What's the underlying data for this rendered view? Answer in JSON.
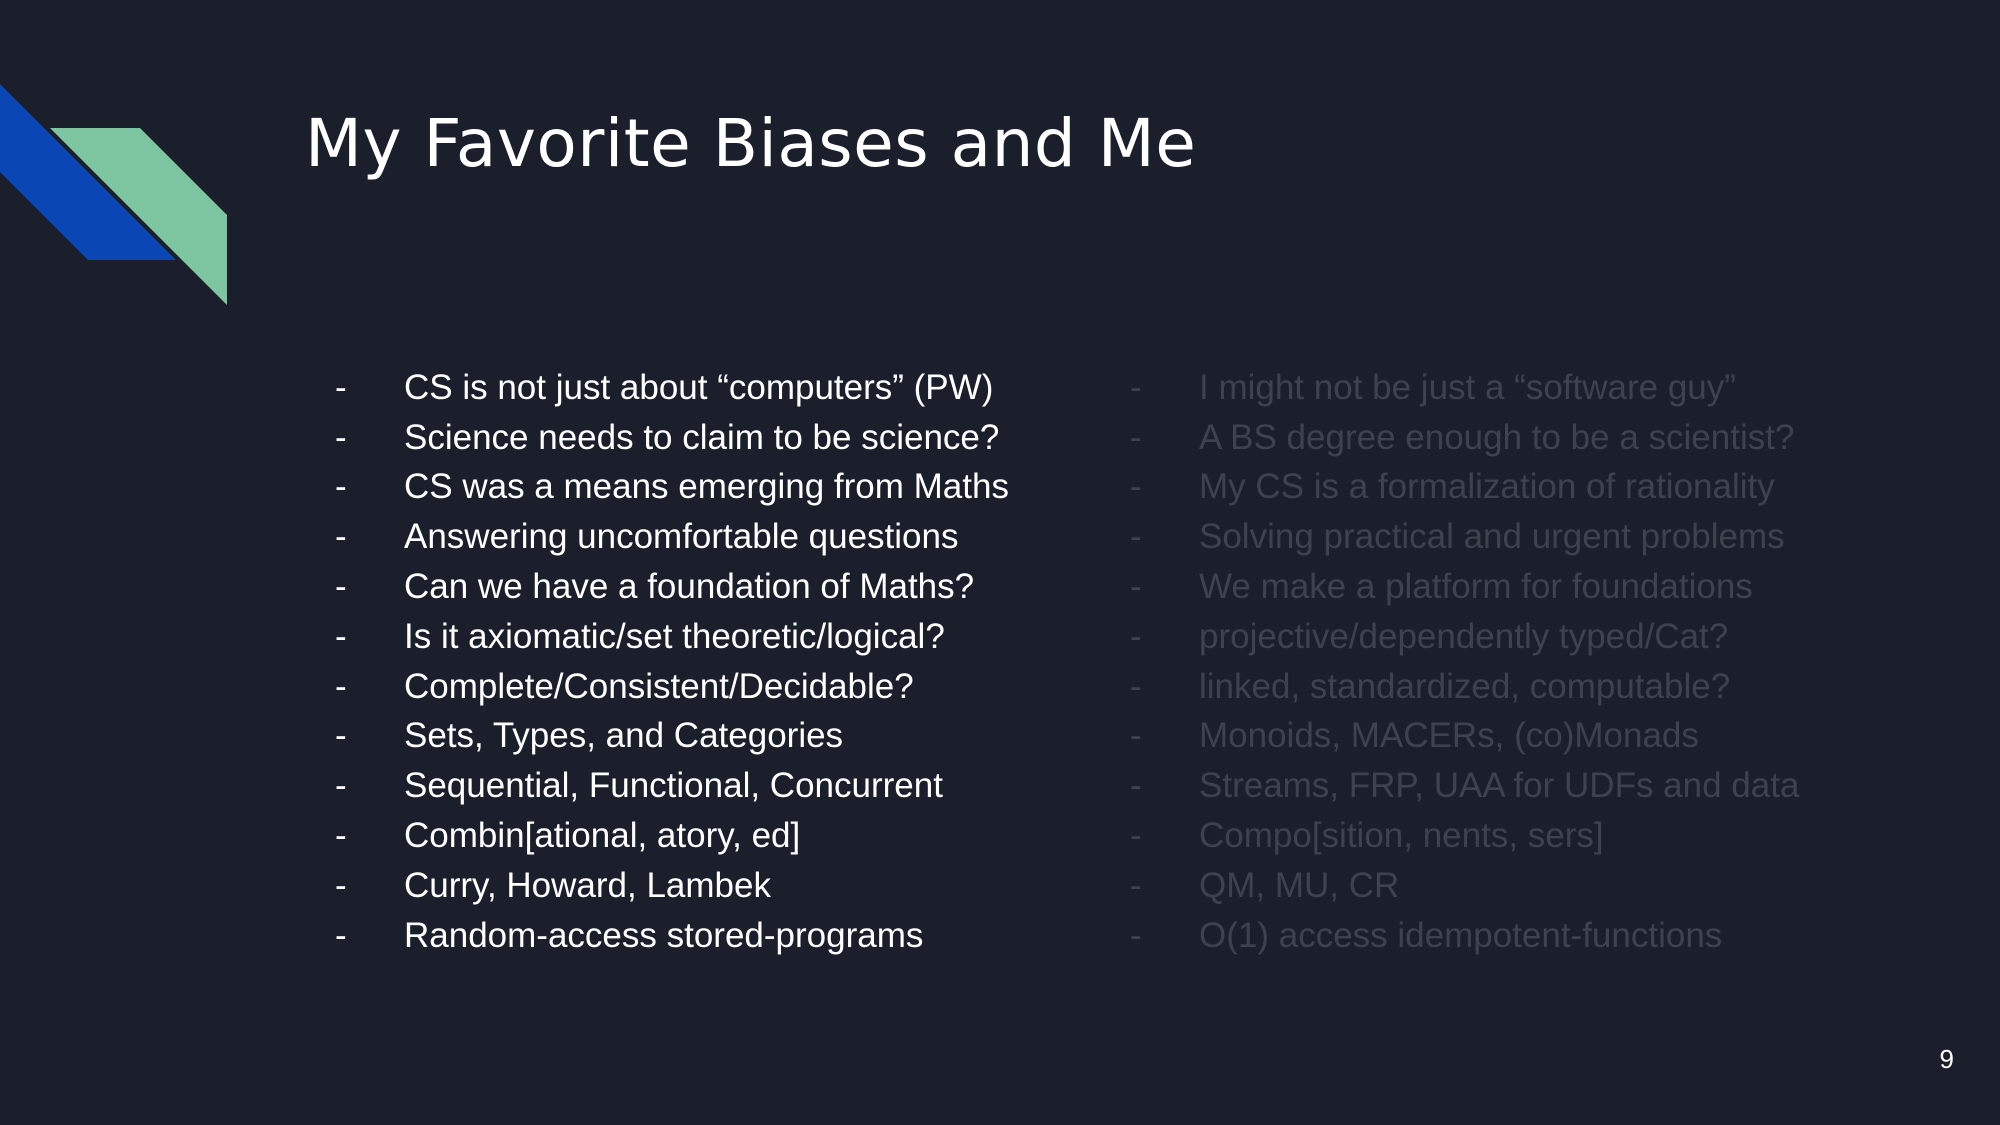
{
  "slide": {
    "title": "My Favorite Biases and Me",
    "page_number": "9",
    "bullet": "-",
    "colors": {
      "background": "#1b1f2b",
      "accent_blue": "#0a47b5",
      "accent_green": "#7ec6a2",
      "text_primary": "#ffffff",
      "text_muted": "#3e424d"
    },
    "left_items": [
      "CS is not just about “computers” (PW)",
      "Science needs to claim to be science?",
      "CS was a means emerging from Maths",
      "Answering uncomfortable questions",
      "Can we have a foundation of Maths?",
      "Is it axiomatic/set theoretic/logical?",
      "Complete/Consistent/Decidable?",
      "Sets, Types, and Categories",
      "Sequential, Functional, Concurrent",
      "Combin[ational, atory, ed]",
      "Curry, Howard, Lambek",
      "Random-access stored-programs"
    ],
    "right_items": [
      "I might not be just a “software guy”",
      "A BS degree enough to be a scientist?",
      "My CS is a formalization of rationality",
      "Solving practical and urgent problems",
      "We make a platform for foundations",
      "projective/dependently typed/Cat?",
      "linked, standardized, computable?",
      "Monoids, MACERs, (co)Monads",
      "Streams, FRP, UAA for UDFs and data",
      "Compo[sition, nents, sers]",
      "QM, MU, CR",
      "O(1) access idempotent-functions"
    ]
  }
}
